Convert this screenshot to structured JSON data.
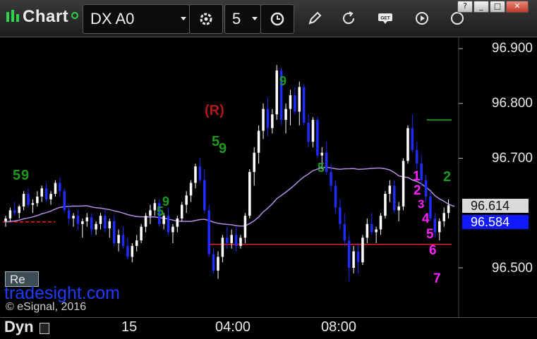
{
  "toolbar": {
    "title": "Chart",
    "symbol": "DX A0",
    "interval": "5"
  },
  "window": {
    "help": "?",
    "minimize": "_",
    "maximize": "□",
    "close": "✕"
  },
  "colors": {
    "up_candle": "#ffffff",
    "down_candle": "#1f2bff",
    "moving_average": "#b48ce6",
    "red_level": "#ff2020",
    "green_level": "#12b81b",
    "magenta_count": "#ff1fff",
    "green_count": "#1e9a1e",
    "setup_label": "#b01818",
    "watermark": "#1f3cff"
  },
  "chart_data": {
    "type": "candlestick",
    "title": "",
    "ylim": [
      96.42,
      96.92
    ],
    "y_ticks": [
      "96.900",
      "96.800",
      "96.700",
      "96.500"
    ],
    "x_ticks": [
      "15",
      "04:00",
      "08:00"
    ],
    "last_price": "96.614",
    "ma_value": "96.584",
    "ohlc": [
      [
        96.585,
        96.595,
        96.575,
        96.59
      ],
      [
        96.59,
        96.61,
        96.585,
        96.605
      ],
      [
        96.605,
        96.62,
        96.595,
        96.6
      ],
      [
        96.6,
        96.615,
        96.59,
        96.612
      ],
      [
        96.612,
        96.64,
        96.605,
        96.635
      ],
      [
        96.635,
        96.645,
        96.61,
        96.615
      ],
      [
        96.615,
        96.625,
        96.6,
        96.618
      ],
      [
        96.618,
        96.64,
        96.612,
        96.63
      ],
      [
        96.63,
        96.65,
        96.62,
        96.645
      ],
      [
        96.645,
        96.655,
        96.62,
        96.625
      ],
      [
        96.625,
        96.64,
        96.615,
        96.635
      ],
      [
        96.635,
        96.66,
        96.63,
        96.655
      ],
      [
        96.655,
        96.665,
        96.63,
        96.64
      ],
      [
        96.64,
        96.645,
        96.6,
        96.605
      ],
      [
        96.605,
        96.615,
        96.58,
        96.59
      ],
      [
        96.59,
        96.6,
        96.575,
        96.595
      ],
      [
        96.595,
        96.605,
        96.57,
        96.58
      ],
      [
        96.58,
        96.59,
        96.555,
        96.585
      ],
      [
        96.585,
        96.6,
        96.575,
        96.592
      ],
      [
        96.592,
        96.6,
        96.56,
        96.57
      ],
      [
        96.57,
        96.585,
        96.56,
        96.58
      ],
      [
        96.58,
        96.6,
        96.57,
        96.595
      ],
      [
        96.595,
        96.605,
        96.565,
        96.572
      ],
      [
        96.572,
        96.59,
        96.555,
        96.585
      ],
      [
        96.585,
        96.595,
        96.54,
        96.545
      ],
      [
        96.545,
        96.57,
        96.53,
        96.56
      ],
      [
        96.56,
        96.575,
        96.535,
        96.54
      ],
      [
        96.54,
        96.555,
        96.515,
        96.52
      ],
      [
        96.52,
        96.545,
        96.51,
        96.54
      ],
      [
        96.54,
        96.56,
        96.53,
        96.55
      ],
      [
        96.55,
        96.58,
        96.545,
        96.575
      ],
      [
        96.575,
        96.6,
        96.565,
        96.595
      ],
      [
        96.595,
        96.615,
        96.58,
        96.605
      ],
      [
        96.605,
        96.625,
        96.595,
        96.618
      ],
      [
        96.618,
        96.625,
        96.575,
        96.58
      ],
      [
        96.58,
        96.6,
        96.57,
        96.595
      ],
      [
        96.595,
        96.61,
        96.56,
        96.565
      ],
      [
        96.565,
        96.58,
        96.545,
        96.575
      ],
      [
        96.575,
        96.595,
        96.565,
        96.59
      ],
      [
        96.59,
        96.62,
        96.585,
        96.615
      ],
      [
        96.615,
        96.64,
        96.6,
        96.632
      ],
      [
        96.632,
        96.66,
        96.62,
        96.655
      ],
      [
        96.655,
        96.69,
        96.645,
        96.685
      ],
      [
        96.685,
        96.7,
        96.655,
        96.66
      ],
      [
        96.66,
        96.68,
        96.6,
        96.605
      ],
      [
        96.605,
        96.615,
        96.52,
        96.525
      ],
      [
        96.525,
        96.535,
        96.49,
        96.495
      ],
      [
        96.495,
        96.53,
        96.48,
        96.52
      ],
      [
        96.52,
        96.56,
        96.51,
        96.555
      ],
      [
        96.555,
        96.575,
        96.535,
        96.545
      ],
      [
        96.545,
        96.57,
        96.535,
        96.56
      ],
      [
        96.56,
        96.575,
        96.53,
        96.54
      ],
      [
        96.54,
        96.56,
        96.535,
        96.555
      ],
      [
        96.555,
        96.6,
        96.545,
        96.595
      ],
      [
        96.595,
        96.68,
        96.59,
        96.675
      ],
      [
        96.675,
        96.72,
        96.65,
        96.71
      ],
      [
        96.71,
        96.76,
        96.69,
        96.75
      ],
      [
        96.75,
        96.8,
        96.735,
        96.79
      ],
      [
        96.79,
        96.81,
        96.74,
        96.755
      ],
      [
        96.755,
        96.79,
        96.745,
        96.78
      ],
      [
        96.78,
        96.87,
        96.77,
        96.86
      ],
      [
        96.86,
        96.865,
        96.76,
        96.77
      ],
      [
        96.77,
        96.8,
        96.745,
        96.79
      ],
      [
        96.79,
        96.825,
        96.76,
        96.815
      ],
      [
        96.815,
        96.83,
        96.78,
        96.785
      ],
      [
        96.785,
        96.84,
        96.76,
        96.83
      ],
      [
        96.83,
        96.835,
        96.76,
        96.765
      ],
      [
        96.765,
        96.78,
        96.72,
        96.73
      ],
      [
        96.73,
        96.775,
        96.72,
        96.77
      ],
      [
        96.77,
        96.775,
        96.7,
        96.705
      ],
      [
        96.705,
        96.72,
        96.68,
        96.71
      ],
      [
        96.71,
        96.73,
        96.67,
        96.675
      ],
      [
        96.675,
        96.69,
        96.64,
        96.65
      ],
      [
        96.65,
        96.66,
        96.6,
        96.61
      ],
      [
        96.61,
        96.625,
        96.57,
        96.58
      ],
      [
        96.58,
        96.6,
        96.54,
        96.55
      ],
      [
        96.55,
        96.56,
        96.475,
        96.5
      ],
      [
        96.5,
        96.54,
        96.49,
        96.53
      ],
      [
        96.53,
        96.545,
        96.49,
        96.51
      ],
      [
        96.51,
        96.56,
        96.505,
        96.555
      ],
      [
        96.555,
        96.59,
        96.545,
        96.58
      ],
      [
        96.58,
        96.6,
        96.56,
        96.565
      ],
      [
        96.565,
        96.575,
        96.545,
        96.57
      ],
      [
        96.57,
        96.6,
        96.56,
        96.595
      ],
      [
        96.595,
        96.64,
        96.59,
        96.635
      ],
      [
        96.635,
        96.66,
        96.62,
        96.65
      ],
      [
        96.65,
        96.66,
        96.6,
        96.605
      ],
      [
        96.605,
        96.62,
        96.585,
        96.612
      ],
      [
        96.612,
        96.7,
        96.605,
        96.695
      ],
      [
        96.695,
        96.76,
        96.69,
        96.755
      ],
      [
        96.755,
        96.78,
        96.71,
        96.715
      ],
      [
        96.715,
        96.73,
        96.68,
        96.69
      ],
      [
        96.69,
        96.705,
        96.65,
        96.66
      ],
      [
        96.66,
        96.67,
        96.62,
        96.63
      ],
      [
        96.63,
        96.64,
        96.585,
        96.59
      ],
      [
        96.59,
        96.6,
        96.555,
        96.565
      ],
      [
        96.565,
        96.59,
        96.55,
        96.585
      ],
      [
        96.585,
        96.61,
        96.575,
        96.6
      ],
      [
        96.6,
        96.625,
        96.59,
        96.614
      ]
    ],
    "moving_average_endpoints": [
      96.584,
      96.612
    ],
    "horizontal_levels": [
      {
        "value": 96.584,
        "x_from": 0.0,
        "x_to": 0.13,
        "color": "red",
        "style": "dashed"
      },
      {
        "value": 96.543,
        "x_from": 0.45,
        "x_to": 1.0,
        "color": "red",
        "style": "solid"
      },
      {
        "value": 96.77,
        "x_from": 0.93,
        "x_to": 1.0,
        "color": "green",
        "style": "solid"
      }
    ]
  },
  "annotations": {
    "setup": "(R)",
    "count_green": [
      "5",
      "9",
      "5",
      "9",
      "5",
      "9",
      "5",
      "9",
      "2"
    ],
    "count_magenta": [
      "1",
      "2",
      "3",
      "4",
      "5",
      "6",
      "7"
    ]
  },
  "footer": {
    "dyn": "Dyn",
    "re_button": "Re",
    "watermark": "tradesight.com",
    "copyright": "© eSignal, 2016"
  }
}
